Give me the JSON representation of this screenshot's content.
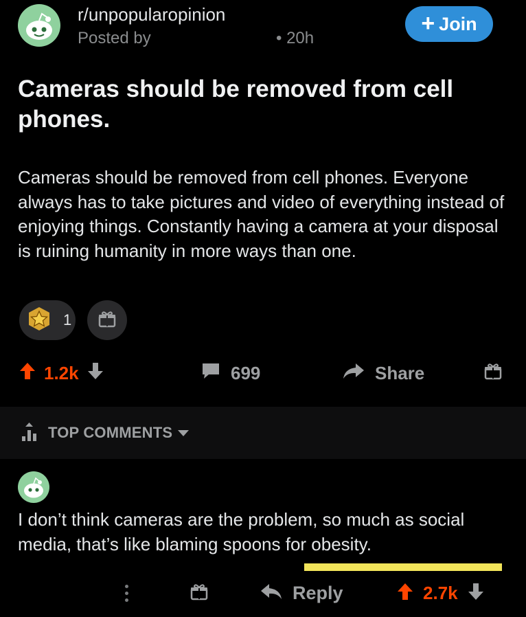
{
  "post": {
    "subreddit": "r/unpopularopinion",
    "posted_by": "Posted by",
    "age": "• 20h",
    "join_label": "Join",
    "title": "Cameras should be removed from cell phones.",
    "body": "Cameras should be removed from cell phones. Everyone always has to take pictures and video of everything instead of enjoying things. Constantly having a camera at your disposal is ruining humanity in more ways than one.",
    "award_count": "1",
    "votes": "1.2k",
    "comments": "699",
    "share_label": "Share"
  },
  "sort": {
    "label": "TOP COMMENTS"
  },
  "comment": {
    "text": "I don’t think cameras are the problem, so much as social media, that’s like blaming spoons for obesity.",
    "reply_label": "Reply",
    "votes": "2.7k"
  },
  "colors": {
    "background": "#000000",
    "upvote": "#ff4500",
    "join_button": "#2f8fd9",
    "highlight": "#f2e45a",
    "muted": "#9ea0a2"
  },
  "icons": [
    "snoo-avatar-icon",
    "plus-icon",
    "award-icon",
    "gift-icon",
    "upvote-icon",
    "downvote-icon",
    "comment-icon",
    "share-icon",
    "sort-icon",
    "caret-down-icon",
    "more-options-icon",
    "reply-icon"
  ]
}
